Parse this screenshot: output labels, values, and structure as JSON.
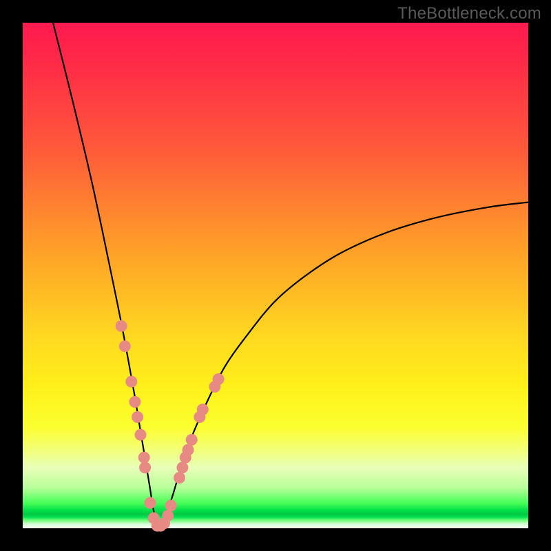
{
  "watermark": "TheBottleneck.com",
  "colors": {
    "curve": "#000000",
    "dot_fill": "#e78a84",
    "dot_stroke": "#cc6f68"
  },
  "chart_data": {
    "type": "line",
    "title": "",
    "xlabel": "",
    "ylabel": "",
    "xlim": [
      0,
      100
    ],
    "ylim": [
      0,
      100
    ],
    "min_x": 27,
    "curve_note": "V-shaped bottleneck curve; y≈0 near x=27; left branch steep, right branch asymptotes around y≈65 at x=100",
    "series": [
      {
        "name": "bottleneck-curve",
        "x": [
          6,
          10,
          14,
          18,
          20,
          22,
          23.5,
          25,
          26,
          27,
          28,
          29.5,
          31,
          33,
          36,
          40,
          45,
          50,
          56,
          63,
          72,
          82,
          92,
          100
        ],
        "y": [
          100,
          84,
          67,
          48,
          38,
          27,
          18,
          9,
          3,
          0,
          2,
          6,
          11,
          17,
          24,
          32,
          39,
          45,
          50,
          54.5,
          58.5,
          61.5,
          63.5,
          64.5
        ]
      }
    ],
    "dots_note": "Approximate salmon-colored sample points clustered along the lower V section",
    "dots": [
      {
        "x": 19.5,
        "y": 40
      },
      {
        "x": 20.2,
        "y": 36
      },
      {
        "x": 21.5,
        "y": 29
      },
      {
        "x": 22.2,
        "y": 25
      },
      {
        "x": 22.7,
        "y": 22
      },
      {
        "x": 23.3,
        "y": 18.5
      },
      {
        "x": 24.0,
        "y": 14
      },
      {
        "x": 24.2,
        "y": 12
      },
      {
        "x": 25.2,
        "y": 5
      },
      {
        "x": 25.9,
        "y": 2
      },
      {
        "x": 26.6,
        "y": 0.5
      },
      {
        "x": 27.3,
        "y": 0.5
      },
      {
        "x": 28.0,
        "y": 1
      },
      {
        "x": 28.7,
        "y": 2.5
      },
      {
        "x": 29.3,
        "y": 4.5
      },
      {
        "x": 31.0,
        "y": 10
      },
      {
        "x": 31.6,
        "y": 12
      },
      {
        "x": 32.2,
        "y": 14
      },
      {
        "x": 32.7,
        "y": 15.5
      },
      {
        "x": 33.4,
        "y": 17.5
      },
      {
        "x": 35.0,
        "y": 22
      },
      {
        "x": 35.6,
        "y": 23.5
      },
      {
        "x": 38.0,
        "y": 28
      },
      {
        "x": 38.7,
        "y": 29.5
      }
    ]
  }
}
